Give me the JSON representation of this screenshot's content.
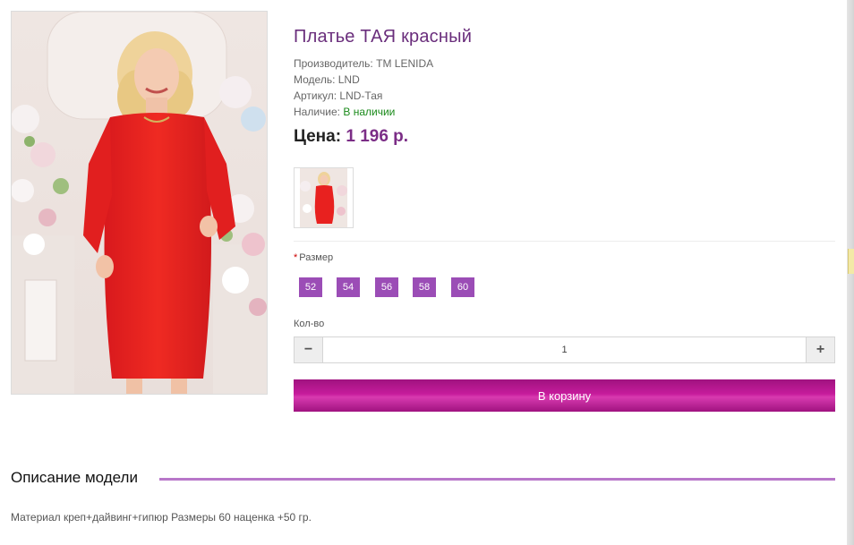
{
  "product": {
    "title": "Платье ТАЯ красный",
    "image_alt": "Model in red dress",
    "specs": [
      {
        "label": "Производитель:",
        "value": "TM LENIDA"
      },
      {
        "label": "Модель:",
        "value": "LND"
      },
      {
        "label": "Артикул:",
        "value": "LND-Тая"
      },
      {
        "label": "Наличие:",
        "value": "В наличии"
      }
    ],
    "price_label": "Цена:",
    "price_value": "1 196 р."
  },
  "options": {
    "size_required_mark": "*",
    "size_label": "Размер",
    "sizes": [
      "52",
      "54",
      "56",
      "58",
      "60"
    ],
    "qty_label": "Кол-во",
    "qty_value": "1",
    "qty_minus": "−",
    "qty_plus": "+"
  },
  "cart": {
    "button_label": "В корзину"
  },
  "description": {
    "heading": "Описание модели",
    "text": "Материал креп+дайвинг+гипюр Размеры 60 наценка +50 гр."
  },
  "colors": {
    "title": "#6a2e7c",
    "price": "#7b2d86",
    "size_button": "#9b4db6",
    "cart_button": "#c61c9c",
    "in_stock": "#1a8a1a",
    "description_rule": "#b877c9"
  },
  "icons": {
    "qty_minus": "minus-icon",
    "qty_plus": "plus-icon"
  }
}
